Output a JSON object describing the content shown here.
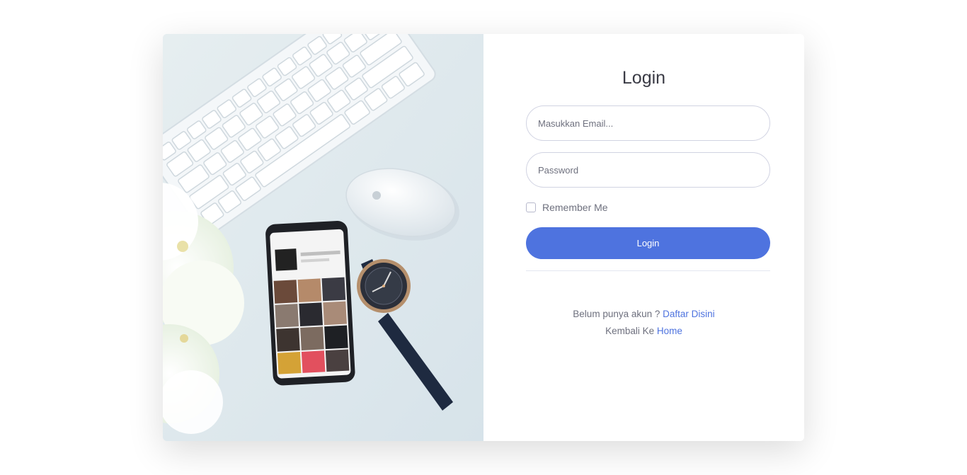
{
  "login": {
    "title": "Login",
    "email_placeholder": "Masukkan Email...",
    "password_placeholder": "Password",
    "remember_label": "Remember Me",
    "submit_label": "Login",
    "register_prompt": "Belum punya akun ?",
    "register_link": "Daftar Disini",
    "home_prompt": "Kembali Ke",
    "home_link": "Home"
  },
  "colors": {
    "accent": "#4e73df",
    "text": "#6e707e",
    "heading": "#3a3b45"
  },
  "hero_image": {
    "icons": [
      "keyboard",
      "mouse",
      "smartphone",
      "wristwatch",
      "flowers"
    ]
  }
}
